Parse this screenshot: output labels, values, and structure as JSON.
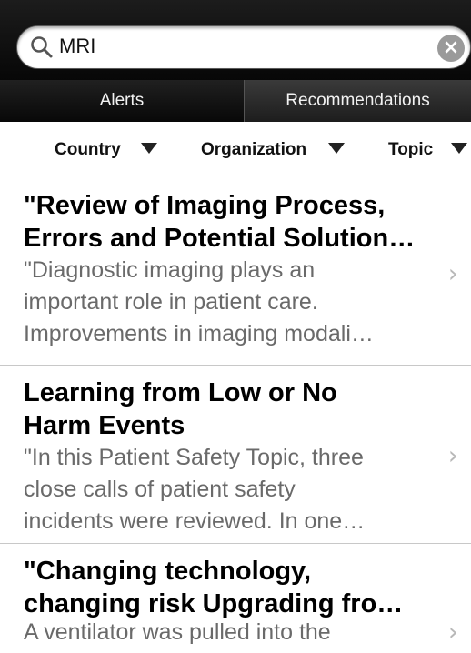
{
  "search": {
    "query": "MRI",
    "clear_icon": "×"
  },
  "tabs": [
    {
      "label": "Alerts",
      "active": true
    },
    {
      "label": "Recommendations",
      "active": false
    }
  ],
  "filters": [
    {
      "label": "Country"
    },
    {
      "label": "Organization"
    },
    {
      "label": "Topic"
    }
  ],
  "items": [
    {
      "title_line1": "\"Review of Imaging Process,",
      "title_line2": "Errors and Potential Solution…",
      "desc_line1": "\"Diagnostic imaging plays an",
      "desc_line2": "important role in patient care.",
      "desc_line3": "Improvements in imaging modali…"
    },
    {
      "title_line1": "Learning from Low or No",
      "title_line2": "Harm Events",
      "desc_line1": "\"In this Patient Safety Topic, three",
      "desc_line2": "close calls of patient safety",
      "desc_line3": "incidents were reviewed.  In one…"
    },
    {
      "title_line1": "\"Changing technology,",
      "title_line2": "changing risk Upgrading fro…",
      "desc_line1": "A ventilator was pulled into the"
    }
  ],
  "chevron": "›"
}
